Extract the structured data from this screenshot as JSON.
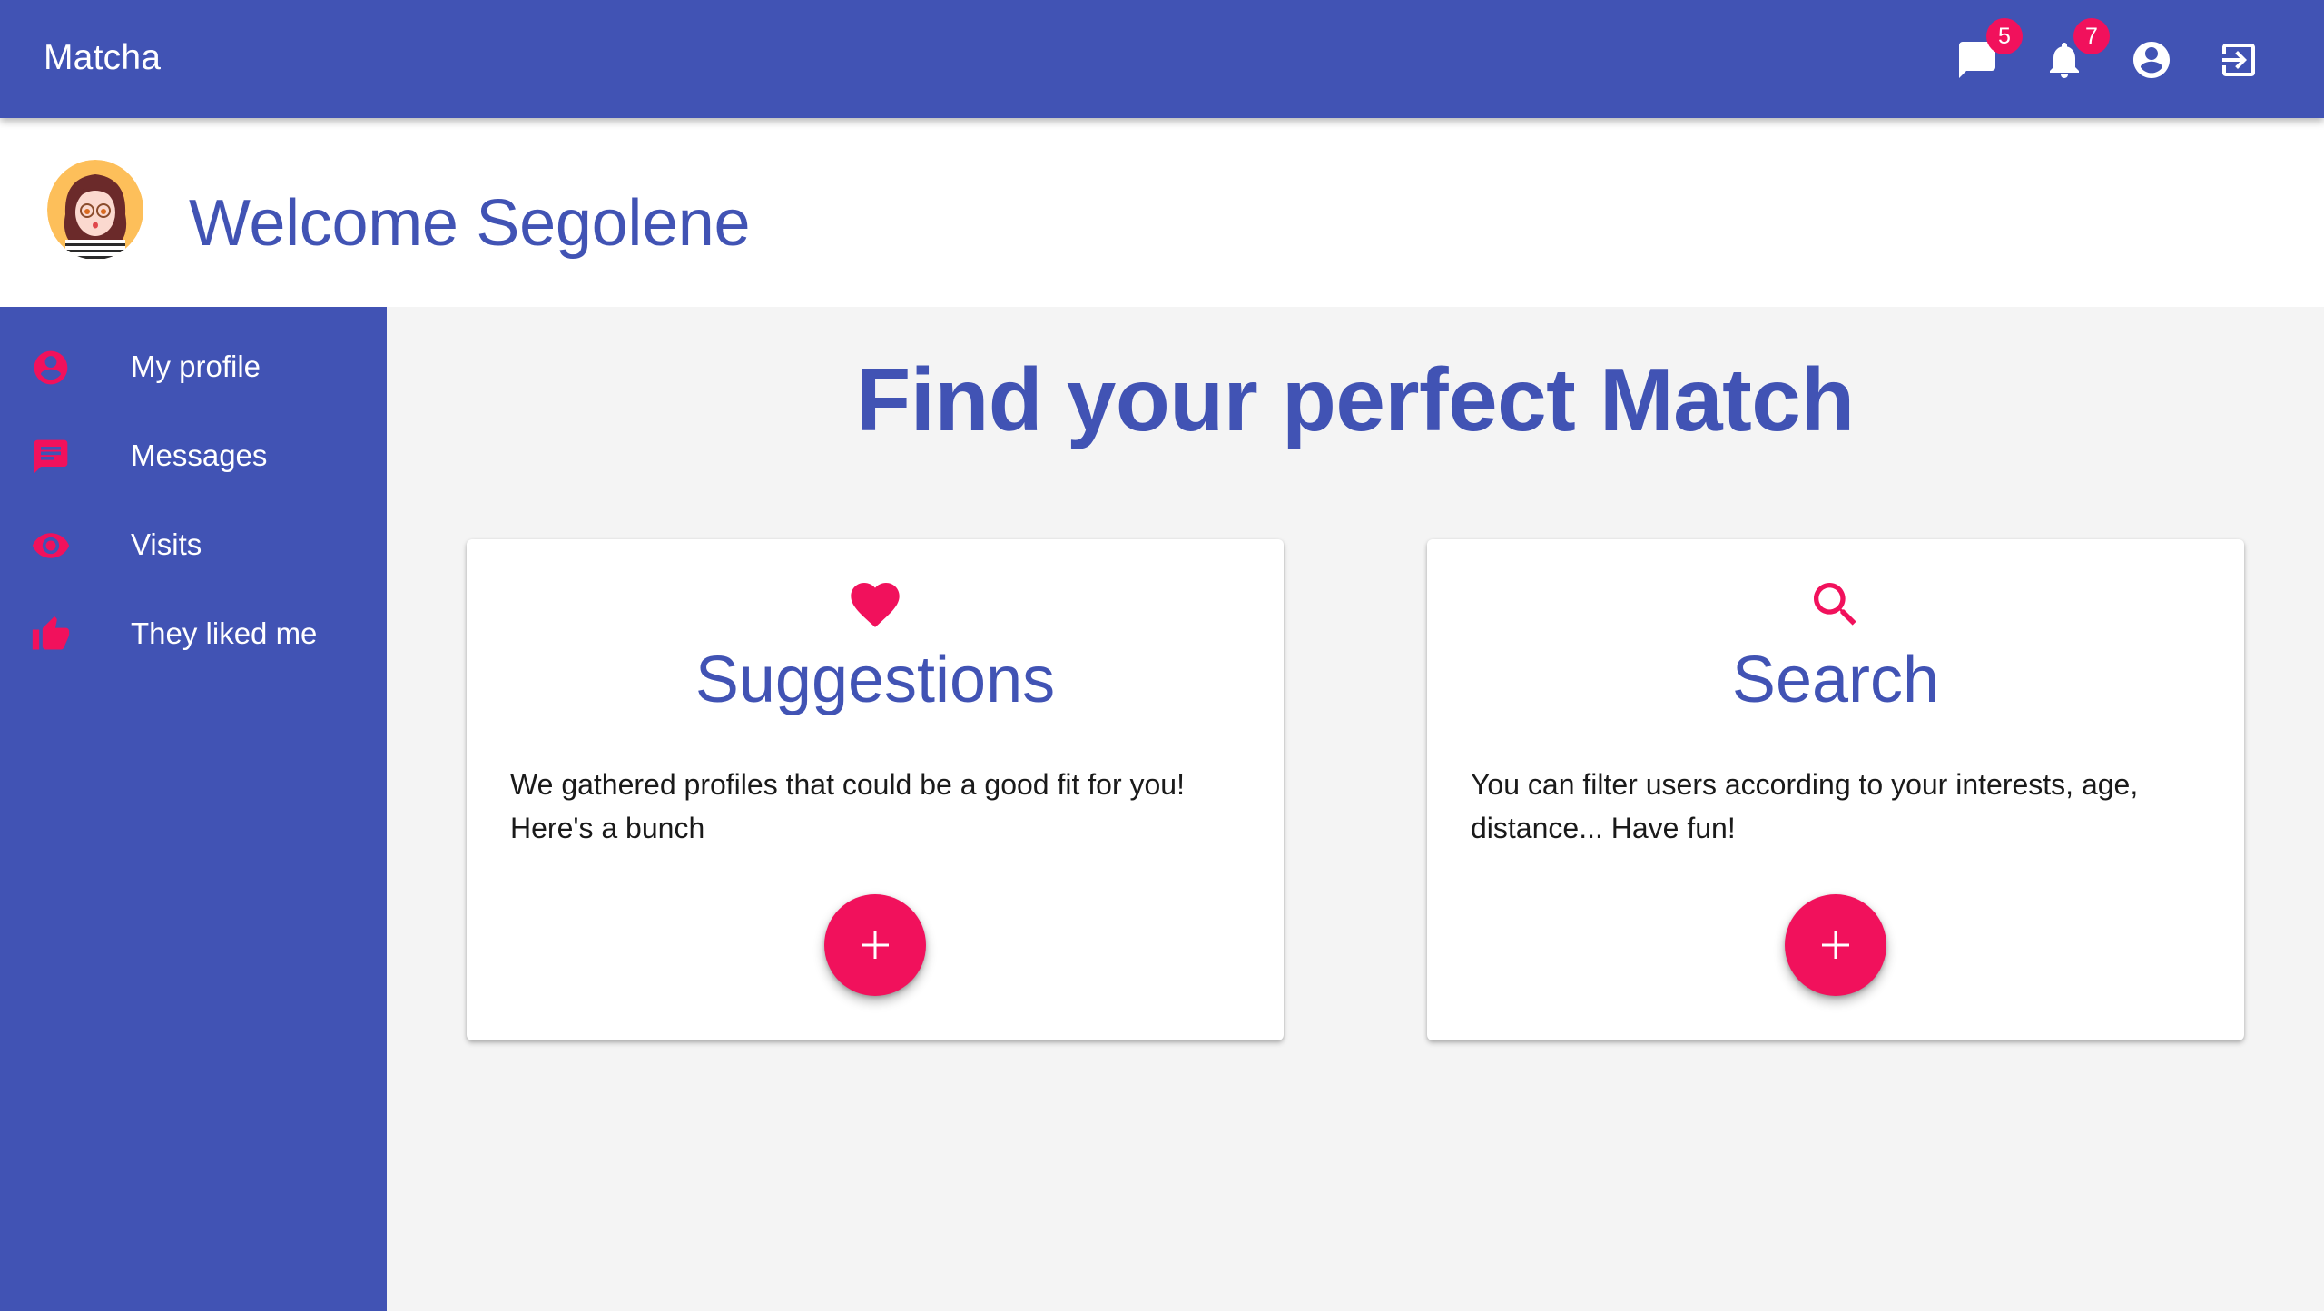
{
  "app": {
    "title": "Matcha",
    "colors": {
      "primary": "#4153b4",
      "accent": "#f1115c",
      "background": "#f4f4f4"
    }
  },
  "topbar": {
    "icons": [
      {
        "name": "messages-icon",
        "badge": "5"
      },
      {
        "name": "notifications-icon",
        "badge": "7"
      },
      {
        "name": "account-icon"
      },
      {
        "name": "logout-icon"
      }
    ]
  },
  "header": {
    "avatar": "user-avatar",
    "welcome": "Welcome Segolene"
  },
  "sidebar": {
    "items": [
      {
        "label": "My profile",
        "icon": "account-circle-icon"
      },
      {
        "label": "Messages",
        "icon": "message-icon"
      },
      {
        "label": "Visits",
        "icon": "eye-icon"
      },
      {
        "label": "They liked me",
        "icon": "thumb-up-icon"
      }
    ]
  },
  "main": {
    "title": "Find your perfect Match",
    "cards": [
      {
        "icon": "heart-icon",
        "title": "Suggestions",
        "body": "We gathered profiles that could be a good fit for you! Here's a bunch",
        "action_icon": "plus-icon"
      },
      {
        "icon": "search-icon",
        "title": "Search",
        "body": "You can filter users according to your interests, age, distance... Have fun!",
        "action_icon": "plus-icon"
      }
    ]
  }
}
